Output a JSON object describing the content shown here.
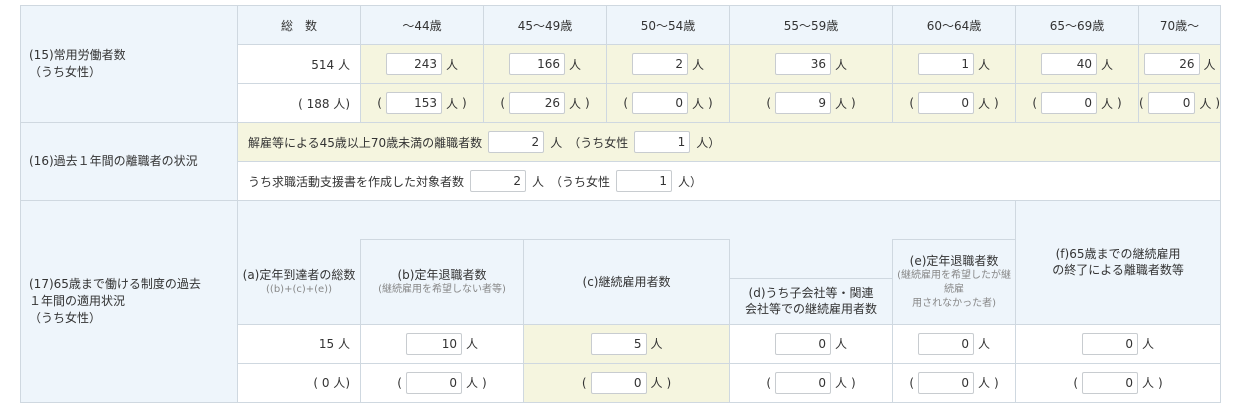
{
  "unit": "人",
  "sec15": {
    "label": "(15)常用労働者数",
    "label2": "（うち女性）",
    "headers": [
      "総　数",
      "～44歳",
      "45～49歳",
      "50～54歳",
      "55～59歳",
      "60～64歳",
      "65～69歳",
      "70歳～"
    ],
    "total": "514",
    "total_women": "188",
    "values": [
      "243",
      "166",
      "2",
      "36",
      "1",
      "40",
      "26"
    ],
    "women": [
      "153",
      "26",
      "0",
      "9",
      "0",
      "0",
      "0"
    ]
  },
  "sec16": {
    "label": "(16)過去１年間の離職者の状況",
    "row1_label": "解雇等による45歳以上70歳未満の離職者数",
    "row1_value": "2",
    "row1_women_label": "（うち女性",
    "row1_women_value": "1",
    "row1_close": "人）",
    "row2_label": "うち求職活動支援書を作成した対象者数",
    "row2_value": "2",
    "row2_women_label": "（うち女性",
    "row2_women_value": "1",
    "row2_close": "人）"
  },
  "sec17": {
    "label1": "(17)65歳まで働ける制度の過去",
    "label2": "１年間の適用状況",
    "label3": "（うち女性）",
    "a": {
      "title": "(a)定年到達者の総数",
      "sub": "((b)+(c)+(e))",
      "value": "15",
      "women": "0"
    },
    "b": {
      "title": "(b)定年退職者数",
      "sub": "(継続雇用を希望しない者等)",
      "value": "10",
      "women": "0"
    },
    "c": {
      "title": "(c)継続雇用者数",
      "value": "5",
      "women": "0"
    },
    "d": {
      "title1": "(d)うち子会社等・関連",
      "title2": "会社等での継続雇用者数",
      "value": "0",
      "women": "0"
    },
    "e": {
      "title": "(e)定年退職者数",
      "sub1": "(継続雇用を希望したが継続雇",
      "sub2": "用されなかった者)",
      "value": "0",
      "women": "0"
    },
    "f": {
      "title1": "(f)65歳までの継続雇用",
      "title2": "の終了による離職者数等",
      "value": "0",
      "women": "0"
    }
  }
}
